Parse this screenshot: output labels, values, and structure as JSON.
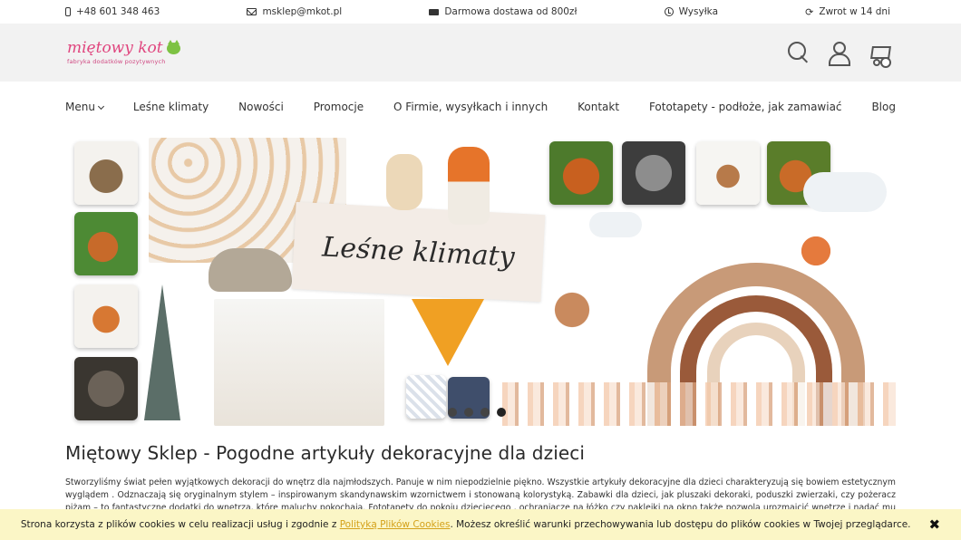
{
  "topbar": {
    "phone": "+48 601 348 463",
    "email": "msklep@mkot.pl",
    "shipping": "Darmowa dostawa od 800zł",
    "delivery": "Wysyłka",
    "returns": "Zwrot w 14 dni"
  },
  "logo": {
    "name": "miętowy kot",
    "tagline": "fabryka dodatków pozytywnych"
  },
  "nav": {
    "items": [
      "Menu",
      "Leśne klimaty",
      "Nowości",
      "Promocje",
      "O Firmie, wysyłkach i innych",
      "Kontakt",
      "Fototapety - podłoże, jak zamawiać",
      "Blog"
    ]
  },
  "banner": {
    "title": "Leśne klimaty",
    "slides": 4,
    "active_slide": 4
  },
  "content": {
    "heading": "Miętowy Sklep - Pogodne artykuły dekoracyjne dla dzieci",
    "paragraph": "Stworzyliśmy świat pełen wyjątkowych dekoracji do wnętrz dla najmłodszych. Panuje w nim niepodzielnie piękno. Wszystkie artykuły dekoracyjne dla dzieci charakteryzują się bowiem estetycznym wyglądem . Odznaczają się oryginalnym stylem – inspirowanym skandynawskim wzornictwem i stonowaną kolorystyką. Zabawki dla dzieci, jak pluszaki dekoraki, poduszki zwierzaki, czy pożeracz piżam – to fantastyczne dodatki do wnętrza, które maluchy pokochają. Fototapety do pokoju dziecięcego , ochraniacze na łóżko czy naklejki na okno także pozwolą urozmaicić wnętrze i nadać mu oryginalnego charakteru."
  },
  "cookie": {
    "text_before": "Strona korzysta z plików cookies w celu realizacji usług i zgodnie z",
    "link": "Polityką Plików Cookies",
    "text_after": ". Możesz określić warunki przechowywania lub dostępu do plików cookies w Twojej przeglądarce.",
    "close": "✖"
  },
  "colors": {
    "logo_pink": "#e0457e",
    "header_bg": "#f2f2f2",
    "cookie_bg": "#fbf6c6",
    "cookie_link": "#d4a11a"
  }
}
